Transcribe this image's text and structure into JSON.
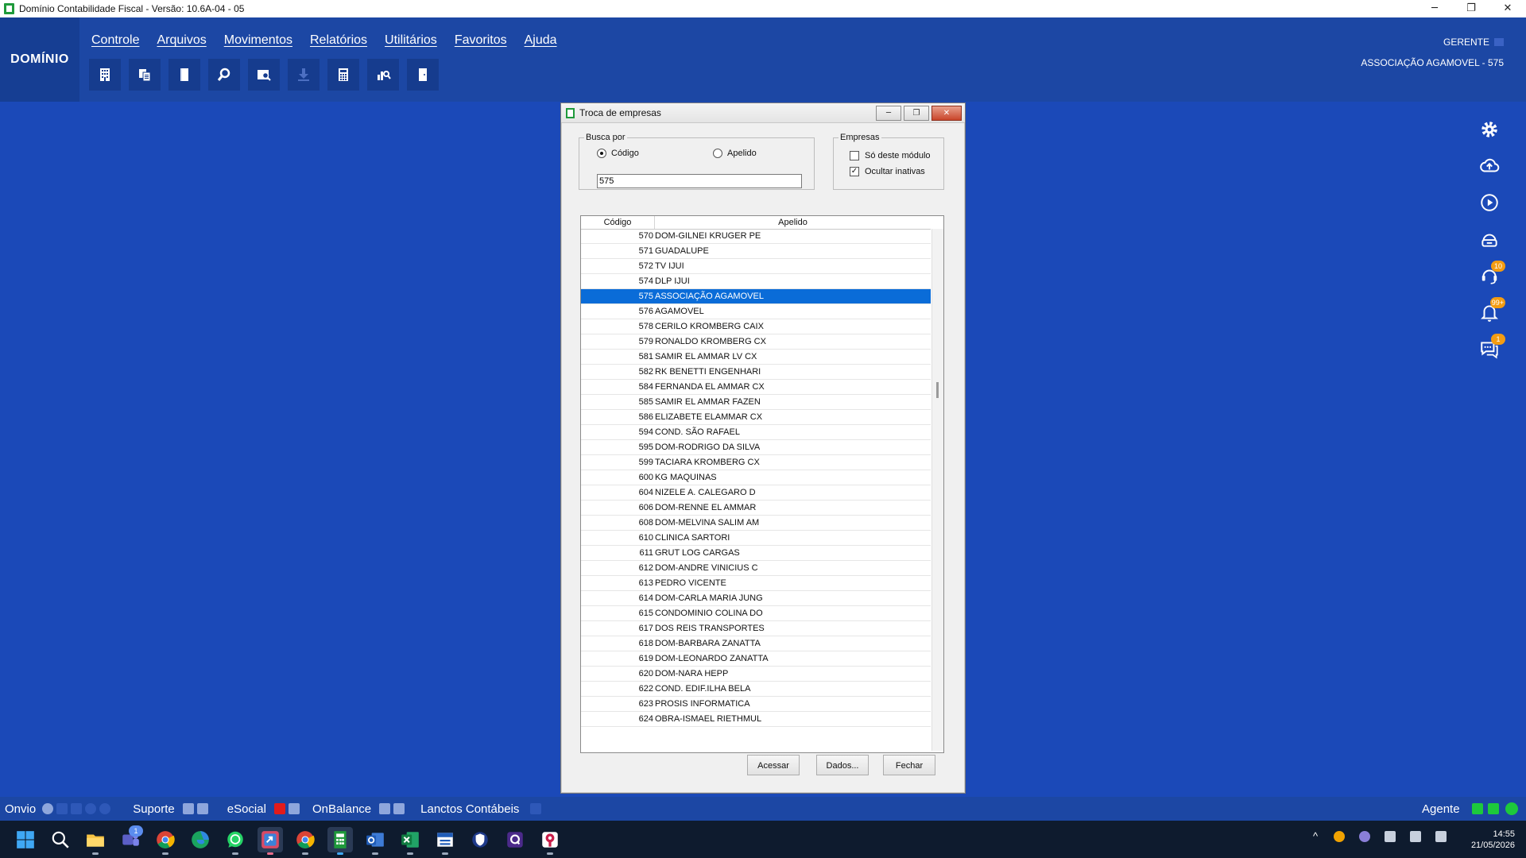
{
  "window": {
    "title": "Domínio Contabilidade Fiscal  - Versão: 10.6A-04 - 05",
    "minimize": "─",
    "maximize": "❐",
    "close": "✕"
  },
  "header": {
    "logo": "DOMÍNIO",
    "menu": [
      "Controle",
      "Arquivos",
      "Movimentos",
      "Relatórios",
      "Utilitários",
      "Favoritos",
      "Ajuda"
    ],
    "toolbar_icons": [
      "building-icon",
      "copy-icon",
      "book-icon",
      "search-icon",
      "inspect-icon",
      "download-icon",
      "calculator-icon",
      "chart-search-icon",
      "door-icon"
    ],
    "user_role": "GERENTE",
    "company": "ASSOCIAÇÃO AGAMOVEL  - 575"
  },
  "sidebar_right": {
    "icons": [
      "gear-icon",
      "cloud-upload-icon",
      "play-icon",
      "headset-box-icon",
      "support-icon",
      "bell-icon",
      "chat-icon"
    ],
    "badges": {
      "support": "10",
      "bell": "99+",
      "chat": "1"
    }
  },
  "dialog": {
    "title": "Troca de empresas",
    "busca_legend": "Busca por",
    "radio_codigo": "Código",
    "radio_apelido": "Apelido",
    "search_value": "575",
    "empresas_legend": "Empresas",
    "check_modulo": "Só deste módulo",
    "check_inativas": "Ocultar inativas",
    "check_mark": "✓",
    "col_codigo": "Código",
    "col_apelido": "Apelido",
    "rows": [
      {
        "code": "570",
        "name": "DOM-GILNEI KRUGER PE"
      },
      {
        "code": "571",
        "name": "GUADALUPE"
      },
      {
        "code": "572",
        "name": "TV IJUI"
      },
      {
        "code": "574",
        "name": "DLP IJUI"
      },
      {
        "code": "575",
        "name": "ASSOCIAÇÃO AGAMOVEL",
        "selected": true
      },
      {
        "code": "576",
        "name": "AGAMOVEL"
      },
      {
        "code": "578",
        "name": "CERILO KROMBERG CAIX"
      },
      {
        "code": "579",
        "name": "RONALDO KROMBERG CX"
      },
      {
        "code": "581",
        "name": "SAMIR EL AMMAR LV CX"
      },
      {
        "code": "582",
        "name": "RK BENETTI ENGENHARI"
      },
      {
        "code": "584",
        "name": "FERNANDA EL AMMAR CX"
      },
      {
        "code": "585",
        "name": "SAMIR EL AMMAR FAZEN"
      },
      {
        "code": "586",
        "name": "ELIZABETE ELAMMAR CX"
      },
      {
        "code": "594",
        "name": "COND. SÃO RAFAEL"
      },
      {
        "code": "595",
        "name": "DOM-RODRIGO DA SILVA"
      },
      {
        "code": "599",
        "name": "TACIARA KROMBERG CX"
      },
      {
        "code": "600",
        "name": "KG MAQUINAS"
      },
      {
        "code": "604",
        "name": "NIZELE A. CALEGARO D"
      },
      {
        "code": "606",
        "name": "DOM-RENNE  EL AMMAR"
      },
      {
        "code": "608",
        "name": "DOM-MELVINA SALIM AM"
      },
      {
        "code": "610",
        "name": "CLINICA SARTORI"
      },
      {
        "code": "611",
        "name": "GRUT LOG CARGAS"
      },
      {
        "code": "612",
        "name": "DOM-ANDRE VINICIUS C"
      },
      {
        "code": "613",
        "name": "PEDRO VICENTE"
      },
      {
        "code": "614",
        "name": "DOM-CARLA MARIA JUNG"
      },
      {
        "code": "615",
        "name": "CONDOMINIO COLINA DO"
      },
      {
        "code": "617",
        "name": "DOS REIS TRANSPORTES"
      },
      {
        "code": "618",
        "name": "DOM-BARBARA ZANATTA"
      },
      {
        "code": "619",
        "name": "DOM-LEONARDO ZANATTA"
      },
      {
        "code": "620",
        "name": "DOM-NARA HEPP"
      },
      {
        "code": "622",
        "name": "COND. EDIF.ILHA BELA"
      },
      {
        "code": "623",
        "name": "PROSIS INFORMATICA"
      },
      {
        "code": "624",
        "name": "OBRA-ISMAEL RIETHMUL"
      }
    ],
    "btn_acessar": "Acessar",
    "btn_dados": "Dados...",
    "btn_fechar": "Fechar"
  },
  "statusbar": {
    "onvio": "Onvio",
    "suporte": "Suporte",
    "esocial": "eSocial",
    "onbalance": "OnBalance",
    "lanctos": "Lanctos Contábeis",
    "agente": "Agente"
  },
  "taskbar": {
    "time": "14:55",
    "date": "21/05/2026",
    "tray_caret": "^",
    "teams_badge": "1"
  },
  "colors": {
    "desktop_bg": "#1B49B8",
    "header_bg": "#1C47A4",
    "selection": "#0A6CD8",
    "badge": "#F39C12",
    "status_green": "#1DC93C"
  }
}
